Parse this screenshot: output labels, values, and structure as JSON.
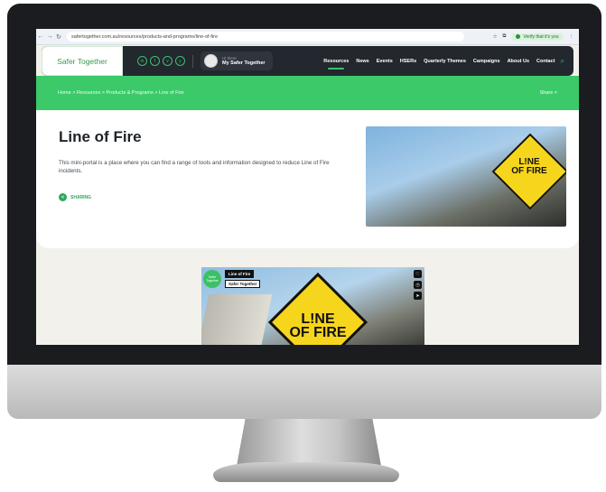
{
  "browser": {
    "url": "safertogether.com.au/resources/products-and-programs/line-of-fire",
    "verify_label": "Verify that it's you",
    "icons": [
      "back-icon",
      "forward-icon",
      "reload-icon",
      "star-icon",
      "extensions-icon",
      "menu-icon"
    ]
  },
  "header": {
    "logo_text": "Safer Together",
    "social": [
      "in",
      "f",
      "v",
      "y"
    ],
    "user_greeting": "Hi there",
    "user_label": "My Safer Together",
    "nav": [
      "Resources",
      "News",
      "Events",
      "HSERs",
      "Quarterly Themes",
      "Campaigns",
      "About Us",
      "Contact"
    ],
    "active_nav": "Resources"
  },
  "breadcrumb": {
    "text": "Home > Resources > Products & Programs > Line of Fire",
    "share_label": "Share <"
  },
  "hero": {
    "title": "Line of Fire",
    "description": "This mini-portal is a place where you can find a range of tools and information designed to reduce Line of Fire incidents.",
    "sharing_label": "SHARING",
    "sign_text_1": "L!NE",
    "sign_text_2": "OF FIRE"
  },
  "video": {
    "logo_text": "Safer Together",
    "tag_title": "Line of Fire",
    "tag_channel": "Safer Together",
    "sign_text_1": "L!NE",
    "sign_text_2": "OF FIRE"
  },
  "colors": {
    "brand_green": "#3cc96a",
    "header_dark": "#23272e",
    "sign_yellow": "#f6d51d"
  }
}
